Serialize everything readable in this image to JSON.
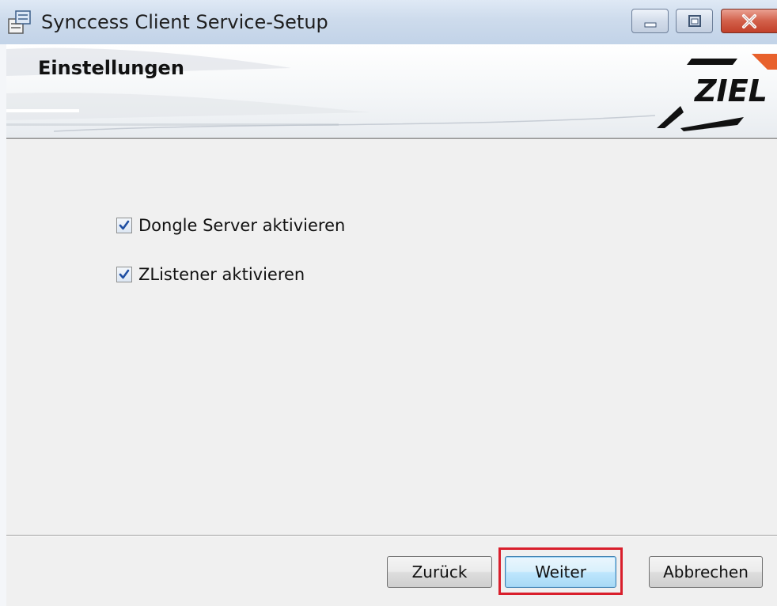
{
  "window": {
    "title": "Synccess Client Service-Setup",
    "icons": [
      "setup-app-icon",
      "minimize-icon",
      "maximize-icon",
      "close-icon"
    ]
  },
  "banner": {
    "title": "Einstellungen",
    "logo_text": "ZIEL"
  },
  "options": [
    {
      "label": "Dongle Server aktivieren",
      "checked": true
    },
    {
      "label": "ZListener aktivieren",
      "checked": true
    }
  ],
  "buttons": {
    "back": "Zurück",
    "next": "Weiter",
    "cancel": "Abbrechen"
  },
  "colors": {
    "highlight": "#d91f2c",
    "logo_accent": "#e8612c",
    "checkmark": "#1f4fa3"
  }
}
